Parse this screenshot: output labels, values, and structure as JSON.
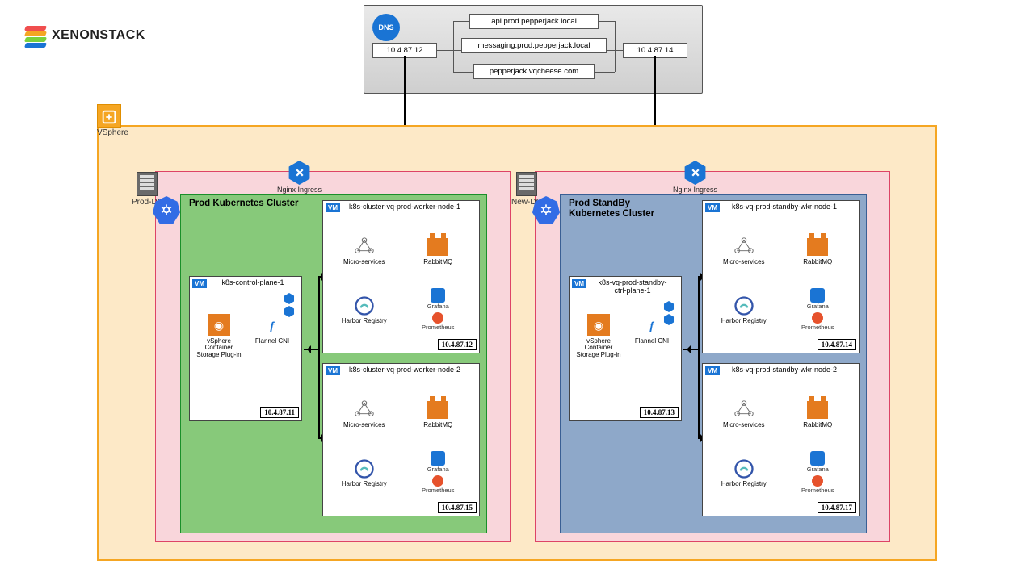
{
  "brand": {
    "name": "XENONSTACK"
  },
  "dns": {
    "label": "DNS",
    "ip_left": "10.4.87.12",
    "ip_right": "10.4.87.14",
    "records": [
      "api.prod.pepperjack.local",
      "messaging.prod.pepperjack.local",
      "pepperjack.vqcheese.com"
    ]
  },
  "vsphere": {
    "label": "VSphere"
  },
  "dc": {
    "left": {
      "name": "Prod-DC"
    },
    "right": {
      "name": "New-DC"
    }
  },
  "ingress": {
    "label": "Nginx Ingress"
  },
  "clusters": {
    "left": {
      "title": "Prod Kubernetes Cluster",
      "control_plane": {
        "name": "k8s-control-plane-1",
        "ip": "10.4.87.11",
        "storage_label": "vSphere Container Storage Plug-in",
        "cni_label": "Flannel CNI"
      },
      "workers": [
        {
          "name": "k8s-cluster-vq-prod-worker-node-1",
          "ip": "10.4.87.12"
        },
        {
          "name": "k8s-cluster-vq-prod-worker-node-2",
          "ip": "10.4.87.15"
        }
      ]
    },
    "right": {
      "title": "Prod StandBy Kubernetes Cluster",
      "control_plane": {
        "name": "k8s-vq-prod-standby-ctrl-plane-1",
        "ip": "10.4.87.13",
        "storage_label": "vSphere Container Storage Plug-in",
        "cni_label": "Flannel CNI"
      },
      "workers": [
        {
          "name": "k8s-vq-prod-standby-wkr-node-1",
          "ip": "10.4.87.14"
        },
        {
          "name": "k8s-vq-prod-standby-wkr-node-2",
          "ip": "10.4.87.17"
        }
      ]
    }
  },
  "workloads": {
    "micro": "Micro-services",
    "rabbit": "RabbitMQ",
    "harbor": "Harbor Registry",
    "grafana": "Grafana",
    "prometheus": "Prometheus"
  },
  "vm_badge": "VM"
}
